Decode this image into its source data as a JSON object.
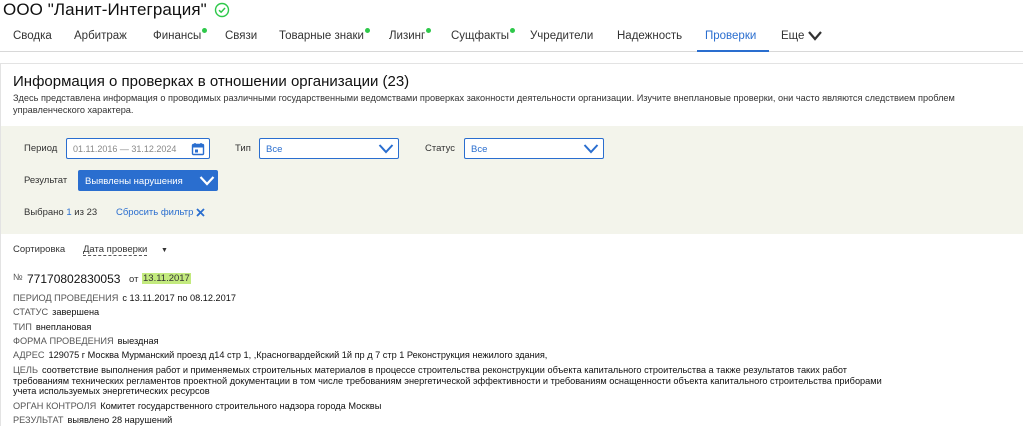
{
  "company": {
    "name": "ООО \"Ланит-Интеграция\""
  },
  "tabs": [
    {
      "label": "Сводка",
      "dot": false
    },
    {
      "label": "Арбитраж",
      "dot": false
    },
    {
      "label": "Финансы",
      "dot": true
    },
    {
      "label": "Связи",
      "dot": false
    },
    {
      "label": "Товарные знаки",
      "dot": true
    },
    {
      "label": "Лизинг",
      "dot": true
    },
    {
      "label": "Сущфакты",
      "dot": true
    },
    {
      "label": "Учредители",
      "dot": false
    },
    {
      "label": "Надежность",
      "dot": false
    },
    {
      "label": "Проверки",
      "dot": false,
      "active": true
    },
    {
      "label": "Еще",
      "dot": false
    }
  ],
  "section": {
    "title": "Информация о проверках в отношении организации (23)",
    "description": "Здесь представлена информация о проводимых различными государственными ведомствами проверках законности деятельности организации. Изучите внеплановые проверки, они часто являются следствием проблем управленческого характера."
  },
  "filters": {
    "period_label": "Период",
    "period_placeholder": "01.11.2016 — 31.12.2024",
    "type_label": "Тип",
    "type_value": "Все",
    "status_label": "Статус",
    "status_value": "Все",
    "result_label": "Результат",
    "result_value": "Выявлены нарушения",
    "selected_prefix": "Выбрано",
    "selected_count": "1",
    "selected_suffix": "из 23",
    "reset_label": "Сбросить фильтр"
  },
  "sort": {
    "label": "Сортировка",
    "value": "Дата проверки"
  },
  "record": {
    "no_label": "№",
    "number": "77170802830053",
    "from_label": "от",
    "date": "13.11.2017",
    "fields": [
      {
        "key": "Период проведения",
        "value": "с 13.11.2017 по 08.12.2017"
      },
      {
        "key": "Статус",
        "value": "завершена"
      },
      {
        "key": "Тип",
        "value": "внеплановая"
      },
      {
        "key": "Форма проведения",
        "value": "выездная"
      },
      {
        "key": "Адрес",
        "value": "129075 г Москва Мурманский проезд д14 стр 1, ,Красногвардейский 1й пр д 7 стр 1 Реконструкция нежилого здания,"
      }
    ],
    "goal_label": "Цель",
    "goal_line1": "соответствие выполнения работ и применяемых строительных материалов в процессе строительства реконструкции объекта капитального строительства а также результатов таких работ",
    "goal_line2": "требованиям технических регламентов проектной документации в том числе требованиям энергетической эффективности и требованиям оснащенности объекта капитального строительства приборами",
    "goal_line3": "учета используемых энергетических ресурсов",
    "org_label": "Орган контроля",
    "org_value": "Комитет государственного строительного надзора города Москвы",
    "result_label": "Результат",
    "result_value": "выявлено 28 нарушений"
  },
  "colors": {
    "accent": "#2a6ecf",
    "dot": "#2ec84a",
    "highlight": "#c3ea7e",
    "filter_bg": "#f3f4eb"
  }
}
